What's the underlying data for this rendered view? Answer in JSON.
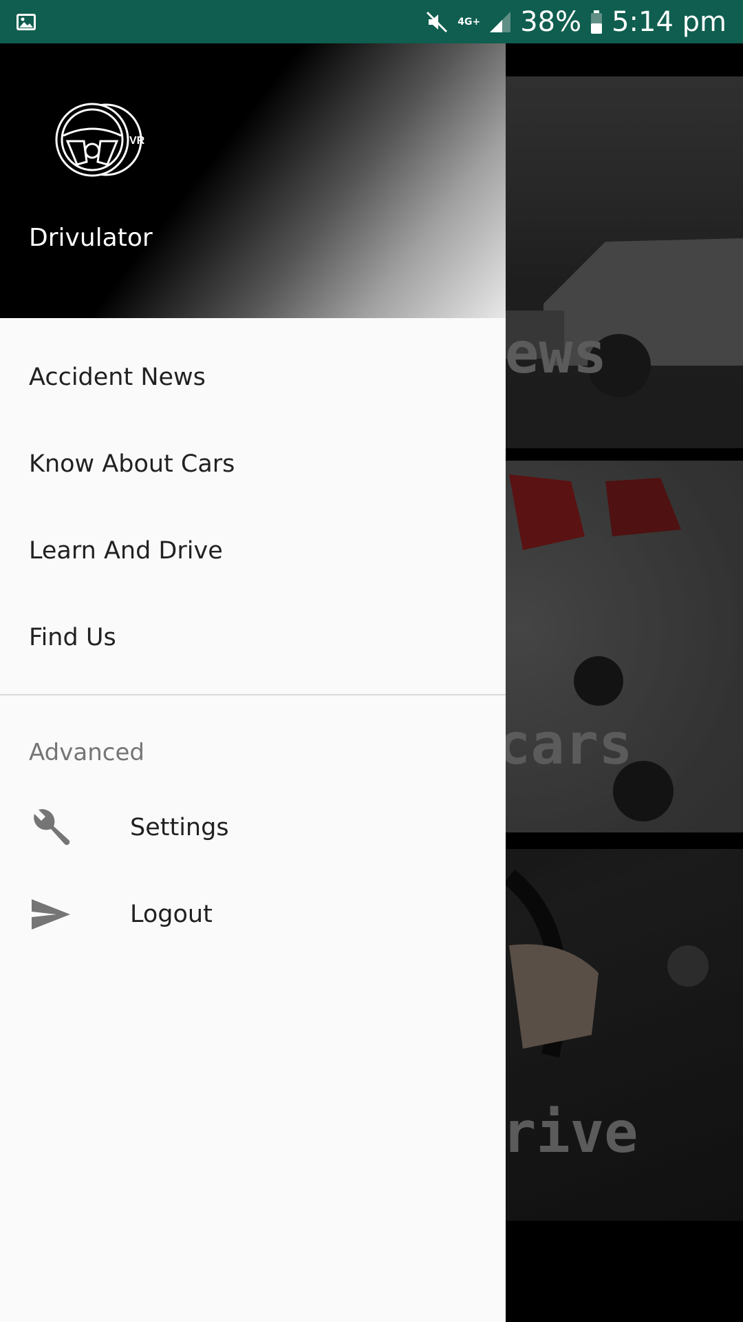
{
  "status_bar": {
    "network": "4G+",
    "battery": "38%",
    "time": "5:14 pm",
    "icons": [
      "gallery-icon",
      "mute-icon",
      "network-icon",
      "signal-icon",
      "battery-icon"
    ]
  },
  "background": {
    "cards": [
      {
        "visible_title": "ews"
      },
      {
        "visible_title": "cars"
      },
      {
        "visible_title": "rive"
      }
    ]
  },
  "drawer": {
    "app_name": "Drivulator",
    "logo_icon": "steering-wheel-vr-logo",
    "items": [
      {
        "label": "Accident News"
      },
      {
        "label": "Know About Cars"
      },
      {
        "label": "Learn And Drive"
      },
      {
        "label": "Find Us"
      }
    ],
    "section_label": "Advanced",
    "advanced_items": [
      {
        "label": "Settings",
        "icon": "wrench-icon"
      },
      {
        "label": "Logout",
        "icon": "send-icon"
      }
    ]
  },
  "colors": {
    "status_bar": "#0f5e4f",
    "drawer_bg": "#fafafa",
    "text_primary": "#212121",
    "text_secondary": "#757575",
    "icon": "#757575"
  }
}
